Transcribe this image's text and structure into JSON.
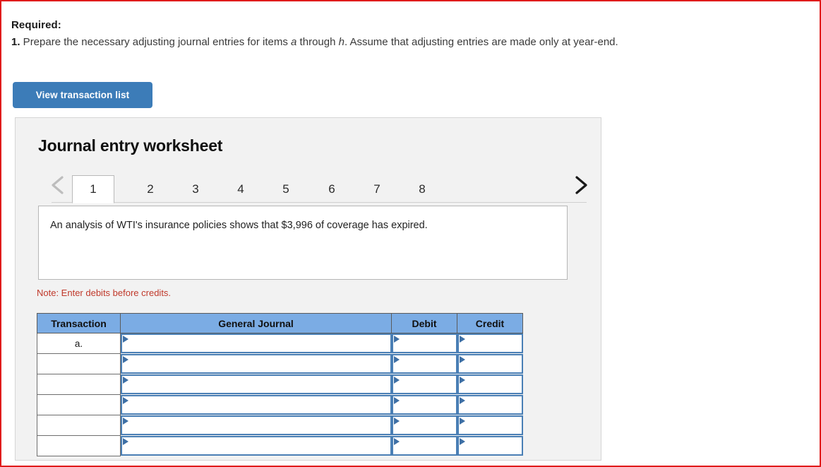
{
  "required": {
    "label": "Required:",
    "item_number": "1.",
    "text_part1": " Prepare the necessary adjusting journal entries for items ",
    "italic_a": "a",
    "text_part2": " through ",
    "italic_h": "h",
    "text_part3": ". Assume that adjusting entries are made only at year-end."
  },
  "toolbar": {
    "view_transaction_list_label": "View transaction list"
  },
  "worksheet": {
    "title": "Journal entry worksheet",
    "prev_arrow": "chevron-left",
    "next_arrow": "chevron-right",
    "tabs": [
      {
        "label": "1",
        "active": true
      },
      {
        "label": "2",
        "active": false
      },
      {
        "label": "3",
        "active": false
      },
      {
        "label": "4",
        "active": false
      },
      {
        "label": "5",
        "active": false
      },
      {
        "label": "6",
        "active": false
      },
      {
        "label": "7",
        "active": false
      },
      {
        "label": "8",
        "active": false
      }
    ],
    "description": "An analysis of WTI's insurance policies shows that $3,996 of coverage has expired.",
    "note": "Note: Enter debits before credits.",
    "table": {
      "headers": [
        "Transaction",
        "General Journal",
        "Debit",
        "Credit"
      ],
      "rows": [
        {
          "transaction": "a.",
          "general_journal": "",
          "debit": "",
          "credit": ""
        },
        {
          "transaction": "",
          "general_journal": "",
          "debit": "",
          "credit": ""
        },
        {
          "transaction": "",
          "general_journal": "",
          "debit": "",
          "credit": ""
        },
        {
          "transaction": "",
          "general_journal": "",
          "debit": "",
          "credit": ""
        },
        {
          "transaction": "",
          "general_journal": "",
          "debit": "",
          "credit": ""
        },
        {
          "transaction": "",
          "general_journal": "",
          "debit": "",
          "credit": ""
        }
      ]
    }
  },
  "colors": {
    "button_blue": "#3c7cb8",
    "table_header_blue": "#7bace4",
    "input_border_blue": "#4a7fb5",
    "note_red": "#c0392b",
    "page_border_red": "#e01b1b",
    "panel_grey": "#f2f2f2"
  }
}
